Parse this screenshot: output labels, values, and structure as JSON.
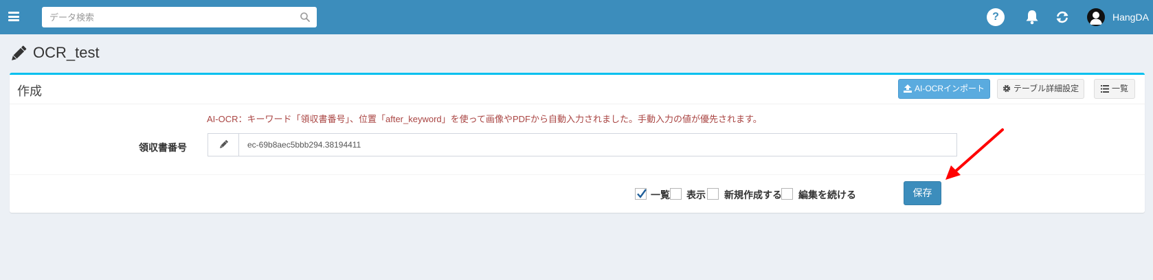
{
  "header": {
    "search_placeholder": "データ検索",
    "username": "HangDA",
    "help_label": "?"
  },
  "page": {
    "title": "OCR_test"
  },
  "card": {
    "title": "作成",
    "buttons": {
      "ocr_import": "AI-OCRインポート",
      "table_settings": "テーブル詳細設定",
      "list": "一覧"
    },
    "notice": "AI-OCR：キーワード「領収書番号」、位置「after_keyword」を使って画像やPDFから自動入力されました。手動入力の値が優先されます。",
    "field": {
      "label": "領収書番号",
      "value": "ec-69b8aec5bbb294.38194411"
    },
    "footer": {
      "options": [
        {
          "label": "一覧",
          "checked": true
        },
        {
          "label": "表示",
          "checked": false
        },
        {
          "label": "新規作成する",
          "checked": false
        },
        {
          "label": "編集を続ける",
          "checked": false
        }
      ],
      "save_label": "保存"
    }
  },
  "colors": {
    "header": "#3c8dbc",
    "card_accent": "#00c0ef",
    "notice": "#a94442",
    "ocr_button": "#5aabdf",
    "save_button": "#3c8dbc",
    "arrow": "#ff0000"
  }
}
